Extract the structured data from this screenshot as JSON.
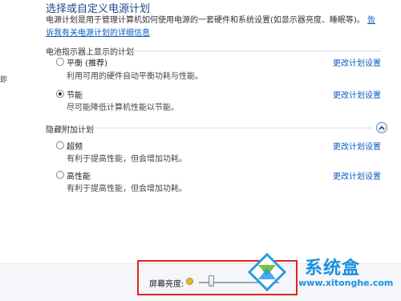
{
  "page": {
    "title": "选择或自定义电源计划",
    "description": "电源计划是用于管理计算机如何使用电源的一套硬件和系统设置(如显示器亮度、睡眠等)。",
    "description_link": "告诉我有关电源计划的详细信息",
    "left_glyph": "即"
  },
  "sections": {
    "battery_meter": "电池指示器上显示的计划",
    "hidden": "隐藏附加计划"
  },
  "plans": [
    {
      "name": "平衡 (推荐)",
      "desc": "利用可用的硬件自动平衡功耗与性能。",
      "selected": false,
      "change": "更改计划设置"
    },
    {
      "name": "节能",
      "desc": "尽可能降低计算机性能以节能。",
      "selected": true,
      "change": "更改计划设置"
    },
    {
      "name": "超频",
      "desc": "有利于提高性能，但会增加功耗。",
      "selected": false,
      "change": "更改计划设置"
    },
    {
      "name": "高性能",
      "desc": "有利于提高性能，但会增加功耗。",
      "selected": false,
      "change": "更改计划设置"
    }
  ],
  "brightness": {
    "label": "屏幕亮度:",
    "level": 0.15
  },
  "watermark": {
    "title": "系统盒",
    "url": "www.xitonghe.com"
  },
  "colors": {
    "link": "#0a5bc4",
    "highlight": "#e2231a",
    "watermark": "#1b8fe0"
  }
}
